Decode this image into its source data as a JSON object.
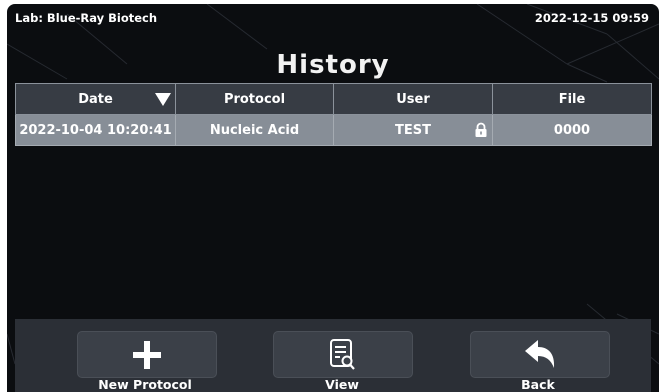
{
  "header": {
    "lab_label": "Lab: Blue-Ray Biotech",
    "datetime": "2022-12-15 09:59"
  },
  "page_title": "History",
  "table": {
    "columns": [
      "Date",
      "Protocol",
      "User",
      "File"
    ],
    "sort_column": "Date",
    "rows": [
      {
        "date": "2022-10-04 10:20:41",
        "protocol": "Nucleic Acid",
        "user": "TEST",
        "file": "0000",
        "locked": true
      }
    ]
  },
  "toolbar": {
    "new_protocol_label": "New Protocol",
    "view_label": "View",
    "back_label": "Back",
    "new_protocol_icon": "plus-icon",
    "view_icon": "document-search-icon",
    "back_icon": "back-arrow-icon"
  },
  "colors": {
    "background": "#0b0d10",
    "header_row": "#373c44",
    "selected_row": "#878e97",
    "button": "#3b4048"
  }
}
